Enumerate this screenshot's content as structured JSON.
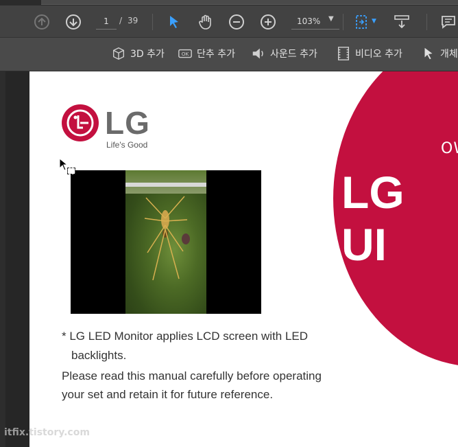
{
  "toolbar": {
    "page_current": "1",
    "page_separator": "/",
    "page_total": "39",
    "zoom": "103%",
    "icons": [
      "arrow-up-icon",
      "arrow-down-icon",
      "select-pointer-icon",
      "hand-tool-icon",
      "zoom-out-icon",
      "zoom-in-icon",
      "zoom-dropdown-icon",
      "fit-page-icon",
      "scroll-mode-icon",
      "comment-icon"
    ]
  },
  "rich_media_toolbar": {
    "items": [
      {
        "label": "3D 추가",
        "icon": "cube-icon"
      },
      {
        "label": "단추 추가",
        "icon": "ok-button-icon"
      },
      {
        "label": "사운드 추가",
        "icon": "speaker-icon"
      },
      {
        "label": "비디오 추가",
        "icon": "film-icon"
      },
      {
        "label": "개체",
        "icon": "pointer-icon"
      }
    ]
  },
  "document": {
    "brand": "LG",
    "tagline": "Life's Good",
    "banner_small": "OW",
    "banner_large": "LG UI",
    "note_line1": "* LG LED Monitor applies LCD screen with LED",
    "note_line2": "backlights.",
    "paragraph_line1": "Please read this manual carefully before operating",
    "paragraph_line2": "your set and retain it for future reference."
  },
  "watermark": "itfix.tistory.com",
  "colors": {
    "brand_red": "#c3103f",
    "accent_blue": "#3aa0ff"
  }
}
